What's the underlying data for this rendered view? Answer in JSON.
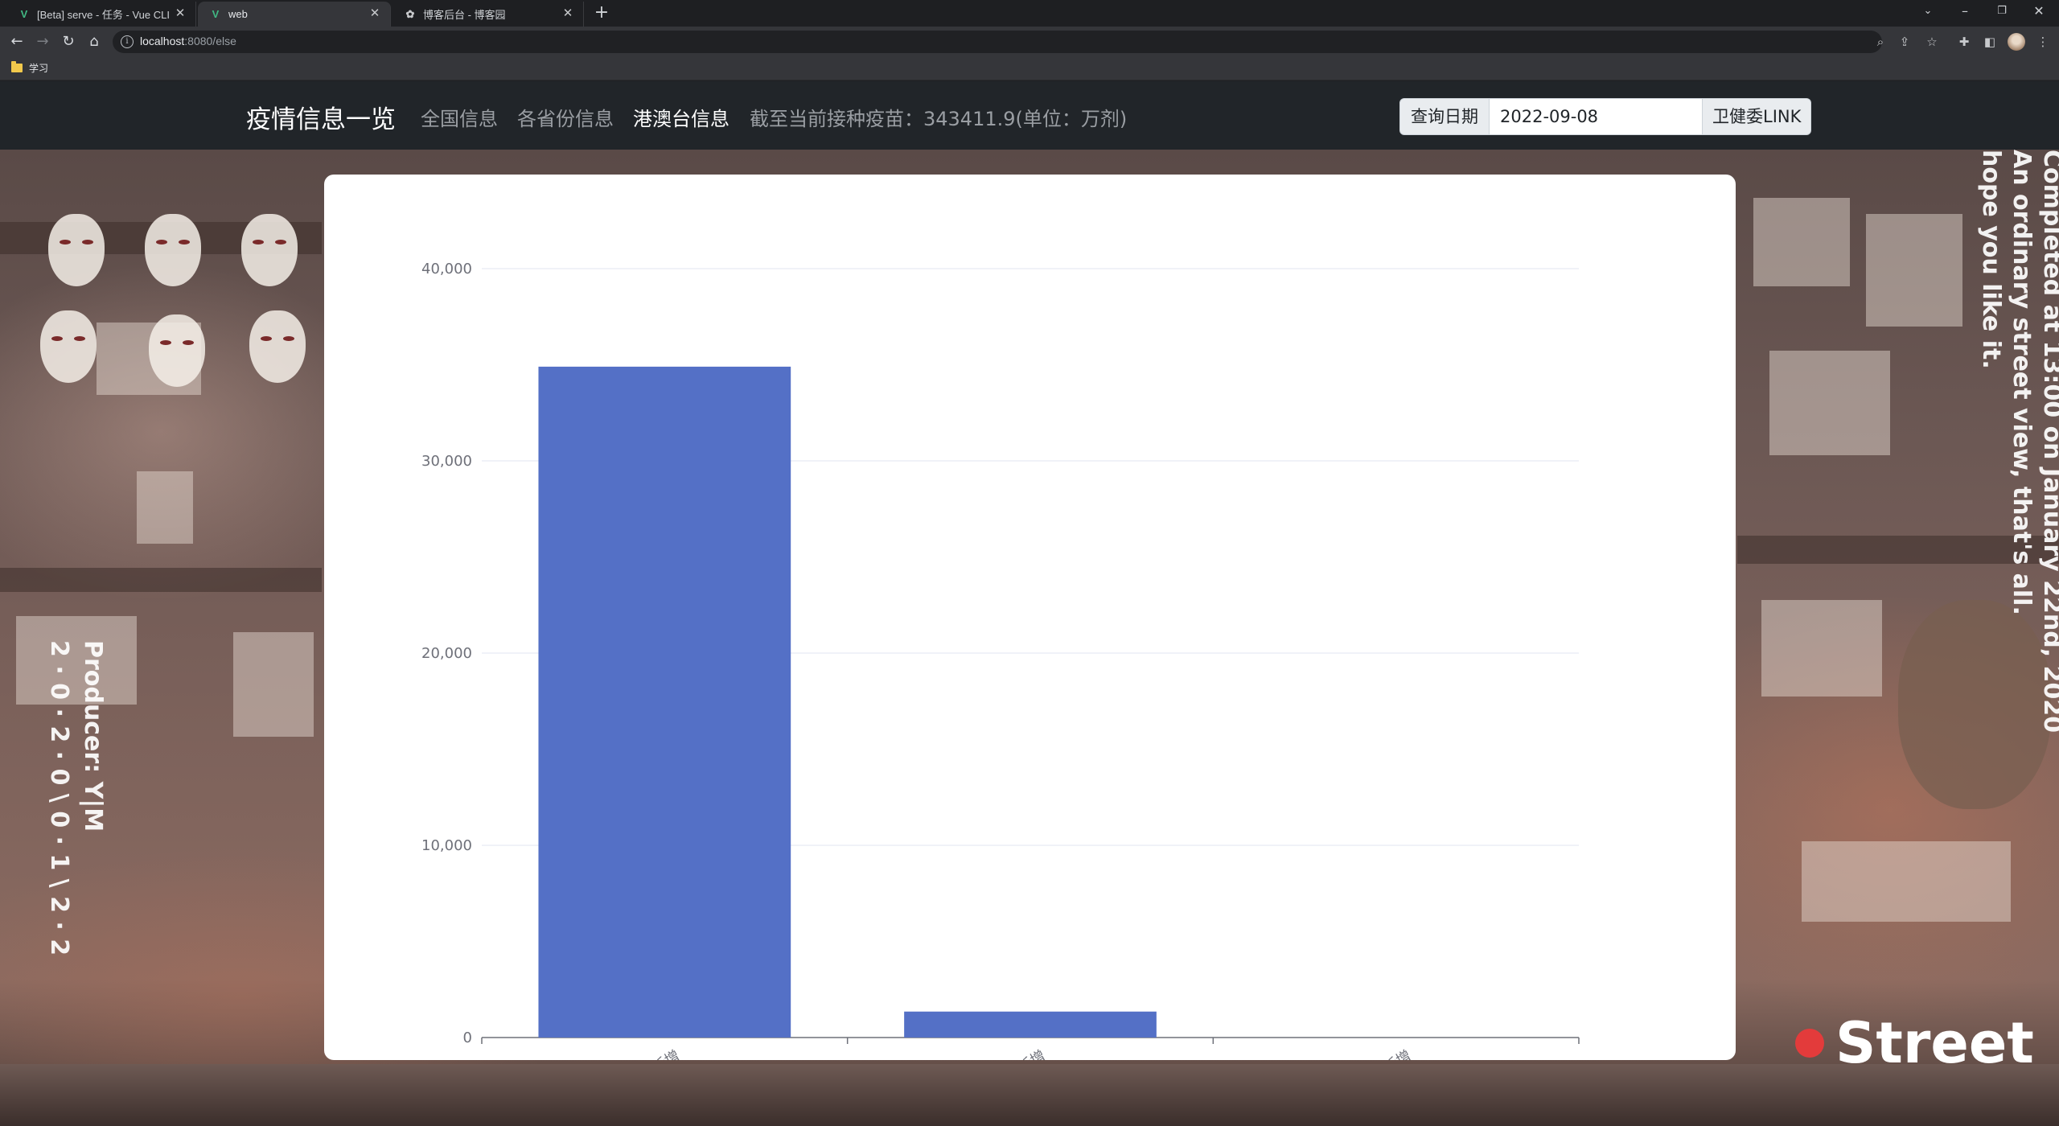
{
  "browser": {
    "tabs": [
      {
        "title": "[Beta] serve - 任务 - Vue CLI",
        "icon": "vue-icon",
        "active": false
      },
      {
        "title": "web",
        "icon": "vue-icon",
        "active": true
      },
      {
        "title": "博客后台 - 博客园",
        "icon": "cnblogs-icon",
        "active": false
      }
    ],
    "url_host": "localhost",
    "url_path": ":8080/else",
    "bookmark": "学习"
  },
  "header": {
    "brand": "疫情信息一览",
    "nav": [
      "全国信息",
      "各省份信息",
      "港澳台信息"
    ],
    "active_nav": "港澳台信息",
    "vaccine_text": "截至当前接种疫苗：343411.9(单位：万剂)",
    "query_label": "查询日期",
    "query_date": "2022-09-08",
    "link_button": "卫健委LINK"
  },
  "background": {
    "right_text": [
      "Completed at 13:00 on January 22nd, 2020",
      "An ordinary street view, that's all.",
      "hope you like it."
    ],
    "left_text": [
      "Producer: Y|M",
      "2 · 0 · 2 · 0 \\ 0 · 1 \\ 2 · 2"
    ],
    "street_label": "Street",
    "accent": "#e33b3b"
  },
  "chart_data": {
    "type": "bar",
    "categories": [
      "台湾当日新增",
      "香港当日新增",
      "澳门当日新增"
    ],
    "values": [
      34900,
      1350,
      0
    ],
    "ylim": [
      0,
      40000
    ],
    "yticks": [
      "0",
      "10,000",
      "20,000",
      "30,000",
      "40,000"
    ],
    "grid": true,
    "bar_color": "#5470c6"
  }
}
